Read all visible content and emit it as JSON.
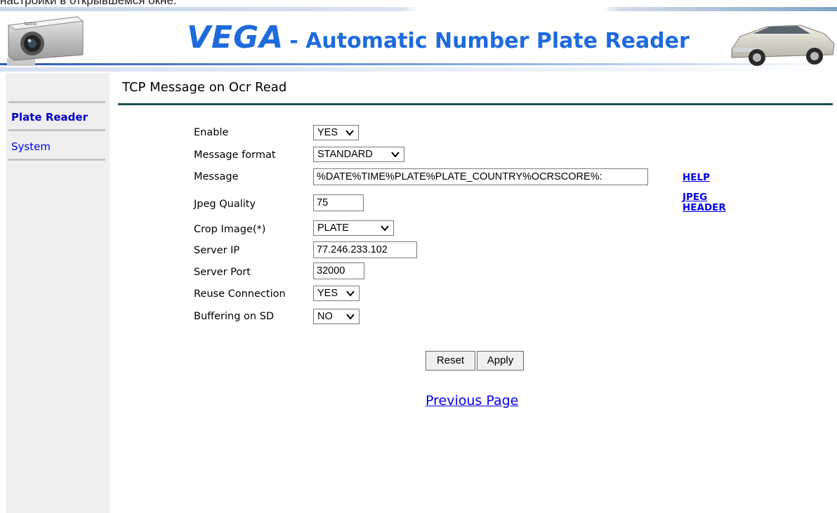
{
  "top_caption": "настройки в открывшемся окне.",
  "banner": {
    "vega": "VEGA",
    "subtitle": "- Automatic Number Plate Reader"
  },
  "sidebar": {
    "items": [
      {
        "label": "Plate Reader",
        "active": true
      },
      {
        "label": "System",
        "active": false
      }
    ]
  },
  "page": {
    "title": "TCP Message on Ocr Read"
  },
  "form": {
    "enable": {
      "label": "Enable",
      "value": "YES"
    },
    "message_format": {
      "label": "Message format",
      "value": "STANDARD"
    },
    "message": {
      "label": "Message",
      "value": "%DATE%TIME%PLATE%PLATE_COUNTRY%OCRSCORE%:"
    },
    "jpeg_quality": {
      "label": "Jpeg Quality",
      "value": "75"
    },
    "crop_image": {
      "label": "Crop Image(*)",
      "value": "PLATE"
    },
    "server_ip": {
      "label": "Server IP",
      "value": "77.246.233.102"
    },
    "server_port": {
      "label": "Server Port",
      "value": "32000"
    },
    "reuse_connection": {
      "label": "Reuse Connection",
      "value": "YES"
    },
    "buffering_sd": {
      "label": "Buffering on SD",
      "value": "NO"
    }
  },
  "links": {
    "help": "HELP",
    "jpeg_header_1": "JPEG",
    "jpeg_header_2": "HEADER",
    "previous_page": "Previous Page"
  },
  "buttons": {
    "reset": "Reset",
    "apply": "Apply"
  },
  "colors": {
    "link": "#0000ee",
    "banner_blue": "#1e6bdc",
    "title_rule": "#1f4f4f",
    "sidebar_bg": "#efefef"
  }
}
